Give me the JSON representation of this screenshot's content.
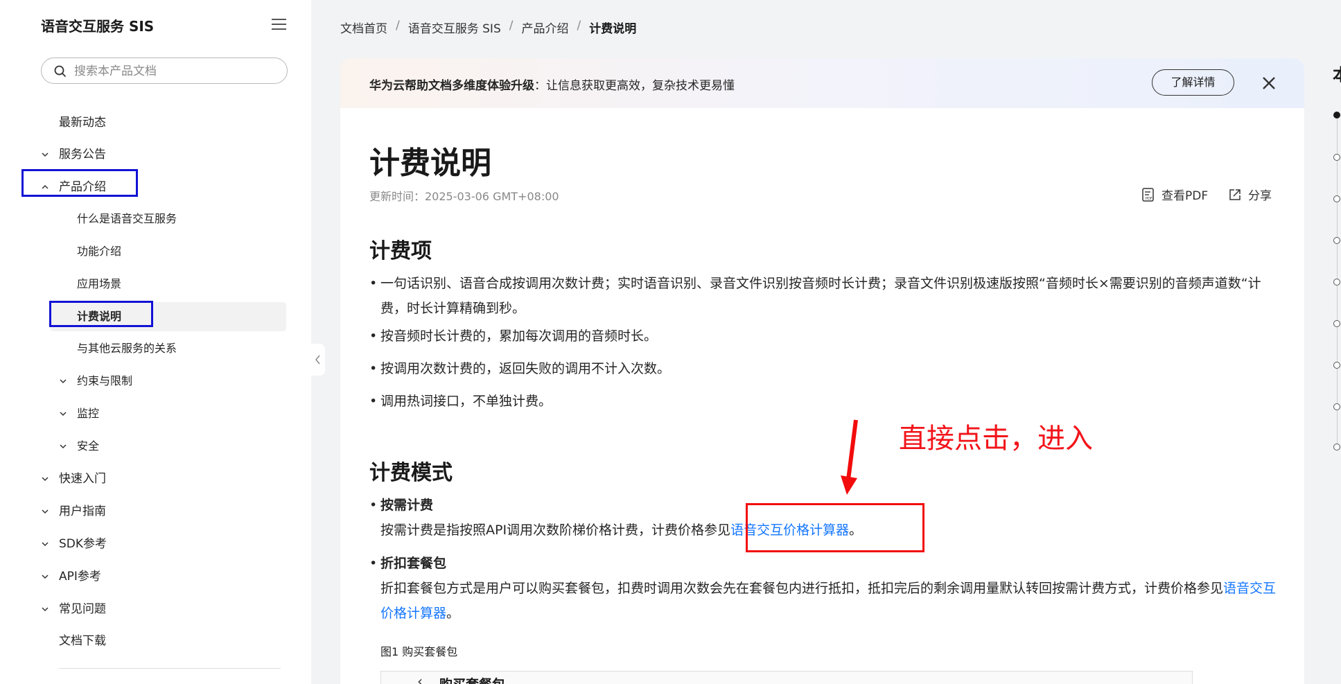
{
  "sidebar": {
    "title": "语音交互服务 SIS",
    "search_placeholder": "搜索本产品文档",
    "items": [
      {
        "label": "最新动态"
      },
      {
        "label": "服务公告"
      },
      {
        "label": "产品介绍"
      },
      {
        "label": "什么是语音交互服务"
      },
      {
        "label": "功能介绍"
      },
      {
        "label": "应用场景"
      },
      {
        "label": "计费说明"
      },
      {
        "label": "与其他云服务的关系"
      },
      {
        "label": "约束与限制"
      },
      {
        "label": "监控"
      },
      {
        "label": "安全"
      },
      {
        "label": "快速入门"
      },
      {
        "label": "用户指南"
      },
      {
        "label": "SDK参考"
      },
      {
        "label": "API参考"
      },
      {
        "label": "常见问题"
      },
      {
        "label": "文档下载"
      }
    ]
  },
  "breadcrumb": [
    "文档首页",
    "语音交互服务 SIS",
    "产品介绍",
    "计费说明"
  ],
  "banner": {
    "bold": "华为云帮助文档多维度体验升级",
    "text": "：让信息获取更高效，复杂技术更易懂",
    "button": "了解详情"
  },
  "page": {
    "title": "计费说明",
    "updated": "更新时间：2025-03-06 GMT+08:00",
    "pdf_label": "查看PDF",
    "share_label": "分享"
  },
  "section1": {
    "heading": "计费项",
    "bullets": [
      "一句话识别、语音合成按调用次数计费；实时语音识别、录音文件识别按音频时长计费；录音文件识别极速版按照“音频时长×需要识别的音频声道数“计费，时长计算精确到秒。",
      "按音频时长计费的，累加每次调用的音频时长。",
      "按调用次数计费的，返回失败的调用不计入次数。",
      "调用热词接口，不单独计费。"
    ]
  },
  "section2": {
    "heading": "计费模式",
    "ondemand_title": "按需计费",
    "ondemand_text": "按需计费是指按照API调用次数阶梯价格计费，计费价格参见",
    "link": "语音交互价格计算器",
    "period": "。",
    "package_title": "折扣套餐包",
    "package_text": "折扣套餐包方式是用户可以购买套餐包，扣费时调用次数会先在套餐包内进行抵扣，抵扣完后的剩余调用量默认转回按需计费方式，计费价格参见",
    "figure_caption": "图1 购买套餐包",
    "figure_title": "购买套餐包"
  },
  "annotation": "直接点击，进入",
  "toc": {
    "heading": "本"
  },
  "colors": {
    "link": "#1476ff",
    "highlight_blue": "#1212d6",
    "annotation_red": "#f20c0c"
  }
}
